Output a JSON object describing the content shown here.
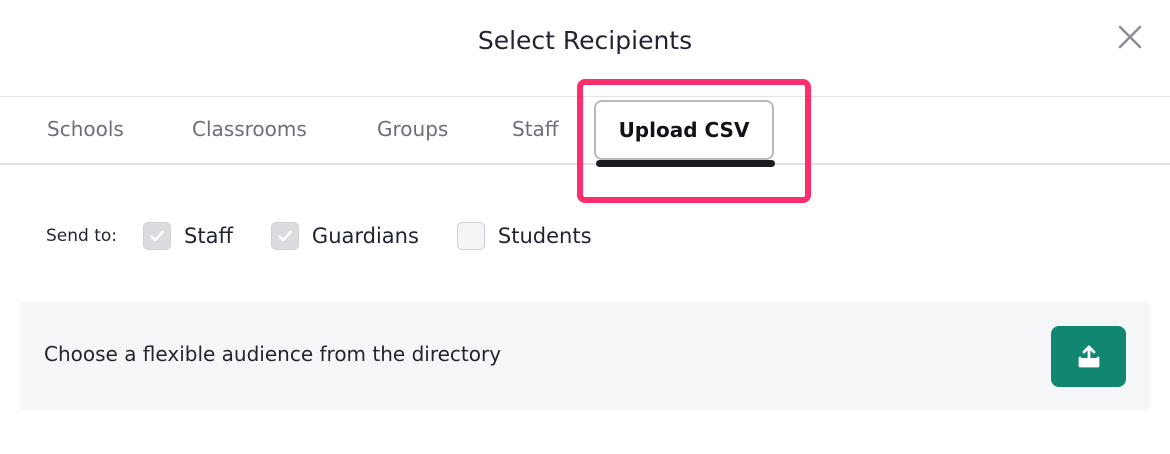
{
  "dialog": {
    "title": "Select Recipients",
    "close_icon": "close-icon"
  },
  "tabs": {
    "items": [
      {
        "label": "Schools"
      },
      {
        "label": "Classrooms"
      },
      {
        "label": "Groups"
      },
      {
        "label": "Staff"
      },
      {
        "label": "Upload CSV"
      }
    ],
    "active": "Upload CSV"
  },
  "send_to": {
    "label": "Send to:",
    "options": [
      {
        "label": "Staff",
        "checked": true
      },
      {
        "label": "Guardians",
        "checked": true
      },
      {
        "label": "Students",
        "checked": false
      }
    ]
  },
  "panel": {
    "text": "Choose a flexible audience from the directory",
    "upload_icon": "upload-icon"
  },
  "colors": {
    "accent_green": "#118772",
    "highlight_pink": "#ff2d6b",
    "active_underline": "#1b1c1f",
    "panel_bg": "#f5f6f8"
  }
}
